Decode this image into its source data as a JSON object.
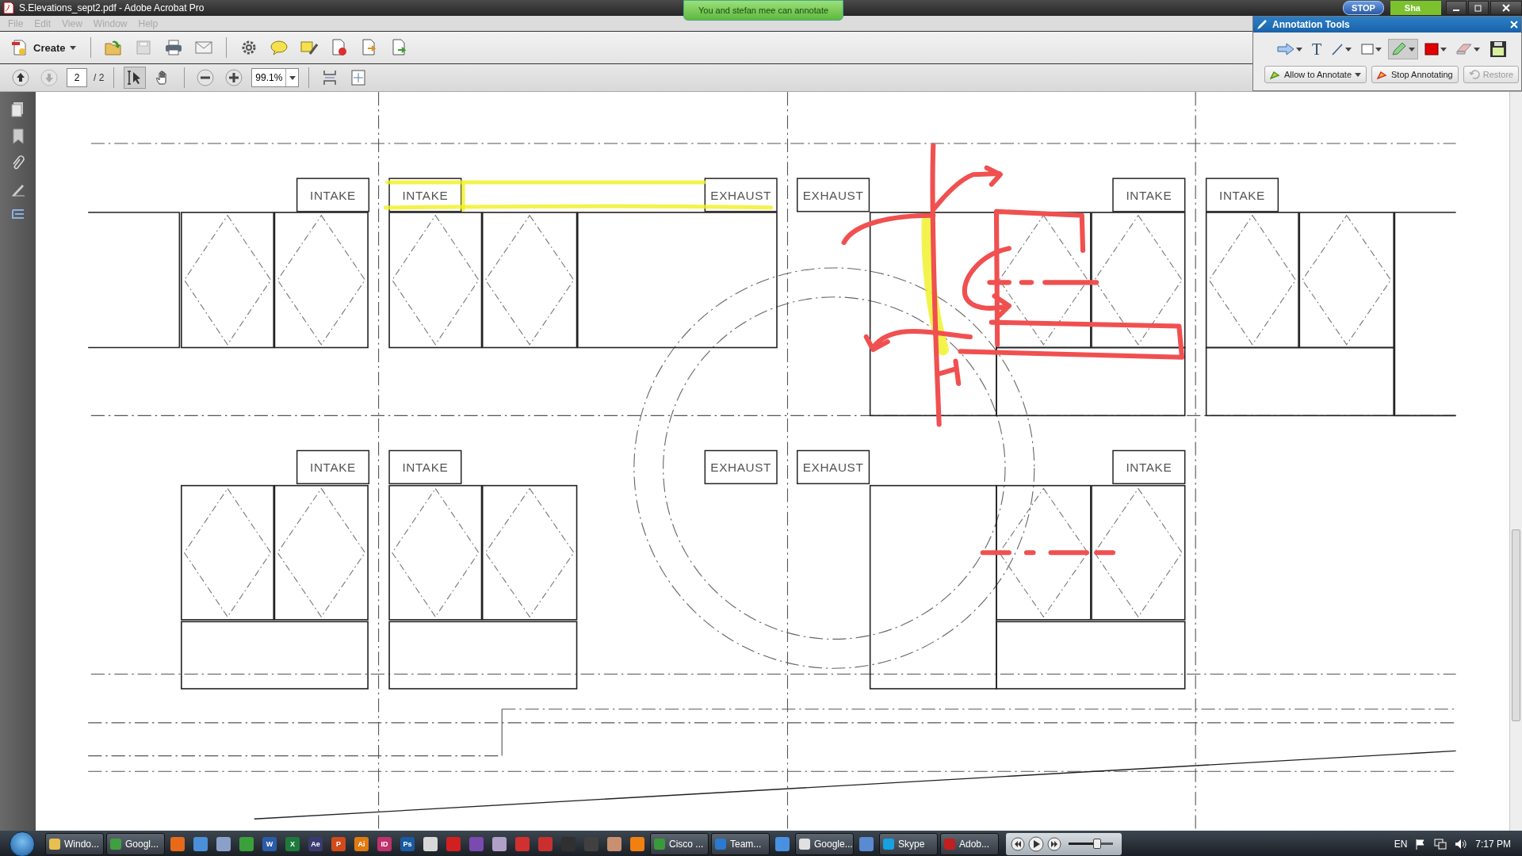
{
  "window": {
    "title": "S.Elevations_sept2.pdf - Adobe Acrobat Pro",
    "title_buttons": [
      {
        "label": "STOP",
        "kind": "stop"
      },
      {
        "label": "Sha",
        "kind": "share"
      }
    ]
  },
  "toast": "You and stefan mee can annotate",
  "menu": [
    {
      "label": "File",
      "disabled": true
    },
    {
      "label": "Edit",
      "disabled": true
    },
    {
      "label": "View",
      "disabled": true
    },
    {
      "label": "Window",
      "disabled": true
    },
    {
      "label": "Help",
      "disabled": true
    }
  ],
  "toolbar": {
    "create": "Create",
    "page": "2",
    "page_total": "/ 2",
    "zoom": "99.1%",
    "tools": [
      {
        "kind": "select",
        "selected": true
      },
      {
        "kind": "hand",
        "selected": false
      }
    ]
  },
  "annotation_panel": {
    "title": "Annotation Tools",
    "tools": [
      {
        "kind": "arrow",
        "selected": false
      },
      {
        "kind": "text",
        "label": "T",
        "selected": false
      },
      {
        "kind": "line",
        "selected": false
      },
      {
        "kind": "rect",
        "selected": false
      },
      {
        "kind": "pencil",
        "selected": true
      },
      {
        "kind": "color",
        "selected": false
      },
      {
        "kind": "eraser",
        "selected": false
      }
    ],
    "buttons": [
      {
        "label": "Allow to Annotate",
        "kind": "dropdown",
        "disabled": false
      },
      {
        "label": "Stop Annotating",
        "kind": "stop",
        "disabled": false
      },
      {
        "label": "Restore",
        "kind": "restore",
        "disabled": true
      }
    ]
  },
  "drawing": {
    "labels": [
      "INTAKE",
      "INTAKE",
      "EXHAUST",
      "EXHAUST",
      "INTAKE",
      "INTAKE",
      "INTAKE",
      "INTAKE",
      "EXHAUST",
      "EXHAUST",
      "INTAKE"
    ]
  },
  "taskbar": {
    "items": [
      {
        "kind": "task",
        "label": "Windo...",
        "color": "#e8c050"
      },
      {
        "kind": "task",
        "label": "Googl...",
        "color": "#40a040"
      },
      {
        "kind": "icon",
        "color": "#e66a1a"
      },
      {
        "kind": "icon",
        "color": "#4a8fd8"
      },
      {
        "kind": "icon",
        "color": "#8aa0c8"
      },
      {
        "kind": "icon",
        "color": "#3aa03a"
      },
      {
        "kind": "icon",
        "color": "#2a5caa",
        "label": "W"
      },
      {
        "kind": "icon",
        "color": "#1e7a3a",
        "label": "X"
      },
      {
        "kind": "icon",
        "color": "#3a3a70",
        "label": "Ae"
      },
      {
        "kind": "icon",
        "color": "#d24a1a",
        "label": "P"
      },
      {
        "kind": "icon",
        "color": "#e07a10",
        "label": "Ai"
      },
      {
        "kind": "icon",
        "color": "#c0306a",
        "label": "ID"
      },
      {
        "kind": "icon",
        "color": "#1a5aa0",
        "label": "Ps"
      },
      {
        "kind": "icon",
        "color": "#d8d8d8"
      },
      {
        "kind": "icon",
        "color": "#d02020"
      },
      {
        "kind": "icon",
        "color": "#7a4ab0"
      },
      {
        "kind": "icon",
        "color": "#b0a0c8"
      },
      {
        "kind": "icon",
        "color": "#d03030"
      },
      {
        "kind": "icon",
        "color": "#c83030"
      },
      {
        "kind": "icon",
        "color": "#303030"
      },
      {
        "kind": "icon",
        "color": "#404040"
      },
      {
        "kind": "icon",
        "color": "#c89070"
      },
      {
        "kind": "icon",
        "color": "#f08010"
      },
      {
        "kind": "task",
        "label": "Cisco ...",
        "color": "#3a9a3a"
      },
      {
        "kind": "task",
        "label": "Team...",
        "color": "#2a7ad0"
      },
      {
        "kind": "icon",
        "color": "#4a90e0"
      },
      {
        "kind": "task",
        "label": "Google...",
        "color": "#e0e0e0"
      },
      {
        "kind": "icon",
        "color": "#5a8ad0"
      },
      {
        "kind": "task",
        "label": "Skype",
        "color": "#18a0e0"
      },
      {
        "kind": "task",
        "label": "Adob...",
        "color": "#c02020"
      }
    ]
  },
  "media": {
    "level": 0.55
  },
  "tray": {
    "language": "EN",
    "clock": "7:17 PM"
  }
}
